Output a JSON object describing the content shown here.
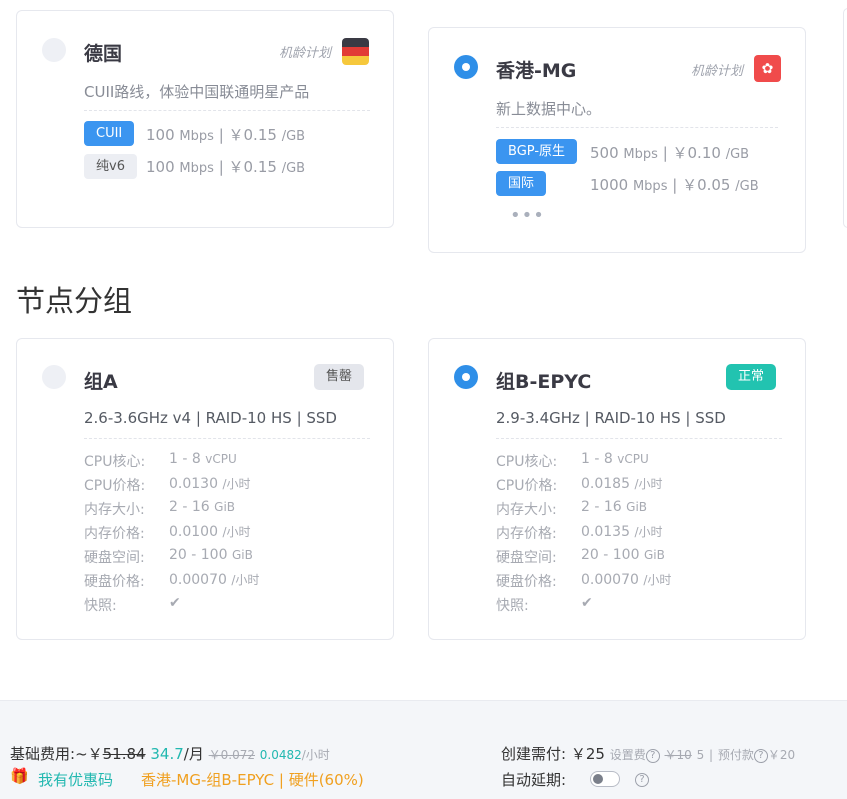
{
  "regions": [
    {
      "name": "德国",
      "plan": "机龄计划",
      "desc": "CUII路线，体验中国联通明星产品",
      "lines": [
        {
          "tag": "CUII",
          "speed": "100",
          "unit": "Mbps",
          "price": "￥0.15",
          "per": "/GB"
        },
        {
          "tag": "纯v6",
          "speed": "100",
          "unit": "Mbps",
          "price": "￥0.15",
          "per": "/GB"
        }
      ]
    },
    {
      "name": "香港-MG",
      "plan": "机龄计划",
      "desc": "新上数据中心。",
      "lines": [
        {
          "tag": "BGP-原生",
          "speed": "500",
          "unit": "Mbps",
          "price": "￥0.10",
          "per": "/GB"
        },
        {
          "tag": "国际",
          "speed": "1000",
          "unit": "Mbps",
          "price": "￥0.05",
          "per": "/GB"
        }
      ],
      "more": "•••"
    }
  ],
  "section_title": "节点分组",
  "groups": [
    {
      "name": "组A",
      "status": "售罄",
      "spec": "2.6-3.6GHz v4 | RAID-10 HS | SSD",
      "rows": [
        {
          "k": "CPU核心:",
          "v": "1 - 8",
          "u": "vCPU"
        },
        {
          "k": "CPU价格:",
          "v": "0.0130",
          "u": "/小时"
        },
        {
          "k": "内存大小:",
          "v": "2 - 16",
          "u": "GiB"
        },
        {
          "k": "内存价格:",
          "v": "0.0100",
          "u": "/小时"
        },
        {
          "k": "硬盘空间:",
          "v": "20 - 100",
          "u": "GiB"
        },
        {
          "k": "硬盘价格:",
          "v": "0.00070",
          "u": "/小时"
        }
      ],
      "snapshot_label": "快照:"
    },
    {
      "name": "组B-EPYC",
      "status": "正常",
      "spec": "2.9-3.4GHz | RAID-10 HS | SSD",
      "rows": [
        {
          "k": "CPU核心:",
          "v": "1 - 8",
          "u": "vCPU"
        },
        {
          "k": "CPU价格:",
          "v": "0.0185",
          "u": "/小时"
        },
        {
          "k": "内存大小:",
          "v": "2 - 16",
          "u": "GiB"
        },
        {
          "k": "内存价格:",
          "v": "0.0135",
          "u": "/小时"
        },
        {
          "k": "硬盘空间:",
          "v": "20 - 100",
          "u": "GiB"
        },
        {
          "k": "硬盘价格:",
          "v": "0.00070",
          "u": "/小时"
        }
      ],
      "snapshot_label": "快照:"
    }
  ],
  "footer": {
    "base_label": "基础费用:",
    "approx": "~￥",
    "old_month": "51.84",
    "new_month": "34.7",
    "per_month": "/月",
    "old_hour": "￥0.072",
    "new_hour": "0.0482",
    "per_hour": "/小时",
    "coupon": "我有优惠码",
    "selection": "香港-MG-组B-EPYC | 硬件(60%)",
    "create_label": "创建需付:",
    "create_price": "￥25",
    "setup_label": "设置费",
    "setup_old": "￥10",
    "setup_new": "5",
    "deposit_label": "预付款",
    "deposit_value": "￥20",
    "renew_label": "自动延期:"
  }
}
